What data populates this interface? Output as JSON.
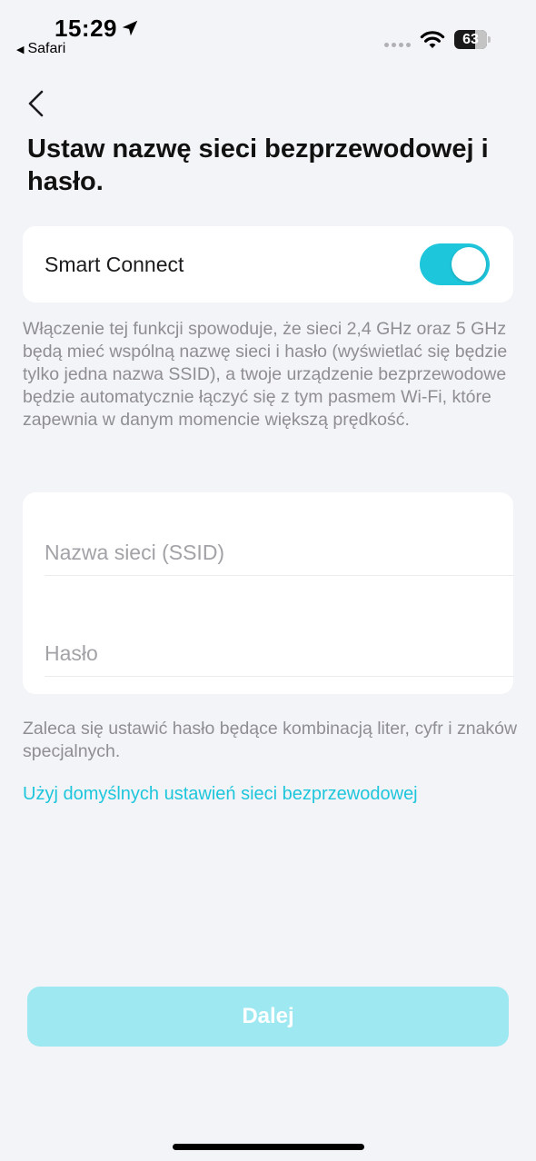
{
  "status_bar": {
    "time": "15:29",
    "back_app": "Safari",
    "battery": "63",
    "battery_level": 0.63
  },
  "nav": {
    "back_icon": "chevron-left-icon"
  },
  "page": {
    "title": "Ustaw nazwę sieci bezprzewodowej i hasło."
  },
  "smart_connect": {
    "label": "Smart Connect",
    "enabled": true,
    "accent": "#1ec6dc",
    "description": "Włączenie tej funkcji spowoduje, że sieci 2,4 GHz oraz 5 GHz będą mieć wspólną nazwę sieci i hasło (wyświetlać się będzie tylko jedna nazwa SSID), a twoje urządzenie bezprzewodowe będzie automatycznie łączyć się z tym pasmem Wi-Fi, które zapewnia w danym momencie większą prędkość."
  },
  "form": {
    "ssid": {
      "placeholder": "Nazwa sieci (SSID)",
      "value": ""
    },
    "password": {
      "placeholder": "Hasło",
      "value": ""
    }
  },
  "hint": "Zaleca się ustawić hasło będące kombinacją liter, cyfr i znaków specjalnych.",
  "default_link": "Użyj domyślnych ustawień sieci bezprzewodowej",
  "next_button": {
    "label": "Dalej",
    "color": "#9ee8f2"
  }
}
